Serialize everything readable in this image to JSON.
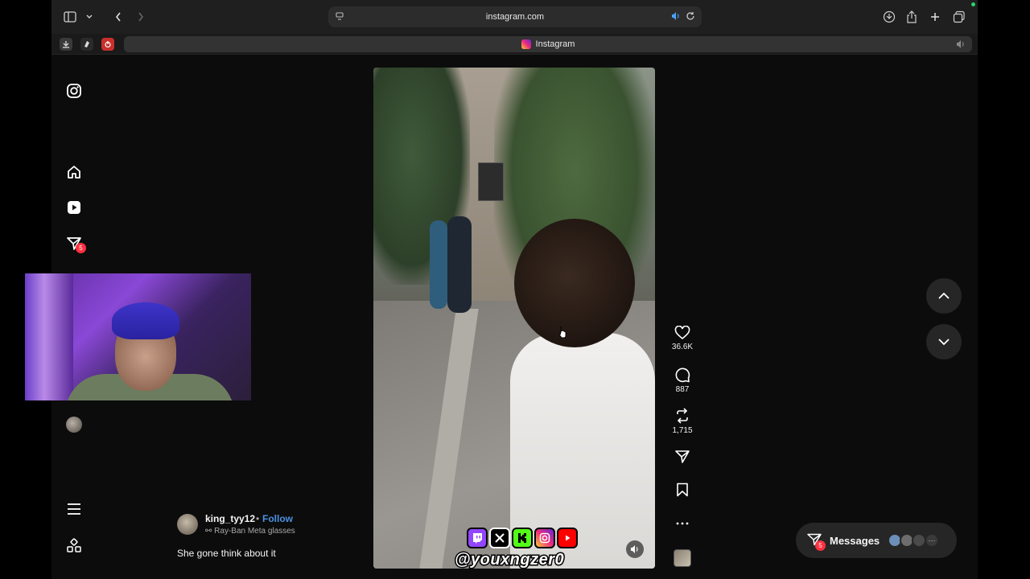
{
  "browser": {
    "url": "instagram.com",
    "tab_title": "Instagram"
  },
  "nav": {
    "notifications_badge": "5"
  },
  "post": {
    "likes": "36.6K",
    "comments": "887",
    "reposts": "1,715",
    "username": "king_tyy12",
    "separator": "•",
    "follow_label": "Follow",
    "device_label": "Ray-Ban Meta glasses",
    "caption": "She gone think about it"
  },
  "messages": {
    "label": "Messages",
    "badge": "5"
  },
  "overlay": {
    "handle": "@youxngzer0",
    "social_icons": [
      "twitch-icon",
      "x-icon",
      "kick-icon",
      "instagram-icon",
      "youtube-icon"
    ]
  },
  "colors": {
    "follow": "#4a90e2",
    "badge": "#ff3040",
    "twitch": "#9146ff",
    "kick": "#53fc18",
    "youtube": "#ff0000"
  }
}
